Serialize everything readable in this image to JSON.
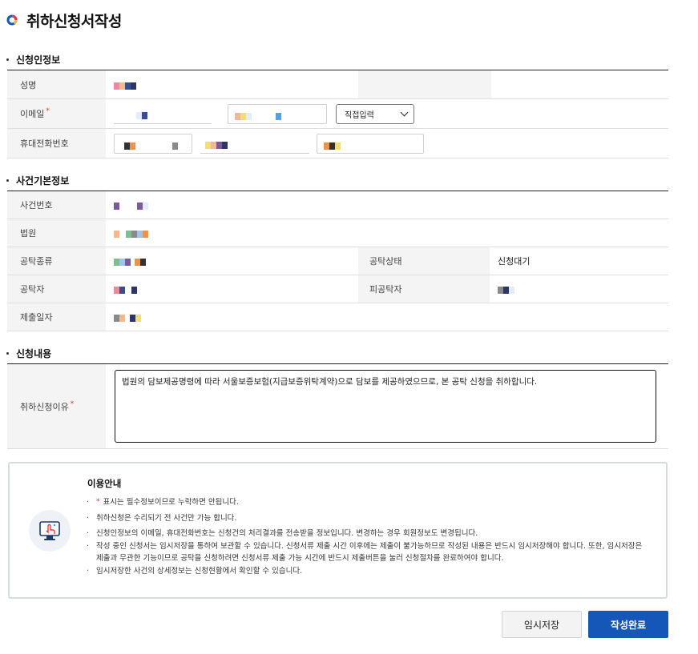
{
  "page": {
    "title": "취하신청서작성"
  },
  "applicant": {
    "section_title": "신청인정보",
    "name_label": "성명",
    "email_label": "이메일",
    "email_domain_select": "직접입력",
    "phone_label": "휴대전화번호"
  },
  "case_info": {
    "section_title": "사건기본정보",
    "case_number_label": "사건번호",
    "court_label": "법원",
    "deposit_type_label": "공탁종류",
    "deposit_status_label": "공탁상태",
    "deposit_status_value": "신청대기",
    "depositor_label": "공탁자",
    "depositee_label": "피공탁자",
    "submit_date_label": "제출일자"
  },
  "request": {
    "section_title": "신청내용",
    "reason_label": "취하신청이유",
    "reason_value": "법원의 담보제공명령에 따라 서울보증보험(지급보증위탁계약)으로 담보를 제공하였으므로, 본 공탁 신청을 취하합니다."
  },
  "guide": {
    "title": "이용안내",
    "items": [
      "표시는 필수정보이므로 누락하면 안됩니다.",
      "취하신청은 수리되기 전 사건만 가능 합니다.",
      "신청인정보의 이메일, 휴대전화번호는 신청건의 처리결과를 전송받을 정보입니다. 변경하는 경우 회원정보도 변경됩니다.",
      "작성 중인 신청서는 임시저장을 통하여 보관할 수 있습니다. 신청서류 제출 시간 이후에는 제출이 불가능하므로 작성된 내용은 반드시 임시저장해야 합니다. 또한, 임시저장은 제출과 무관한 기능이므로 공탁을 신청하려면 신청서류 제출 가능 시간에 반드시 제출버튼을 눌러 신청절차를 완료하여야 합니다.",
      "임시저장한 사건의 상세정보는 신청현황에서 확인할 수 있습니다."
    ]
  },
  "buttons": {
    "temp_save": "임시저장",
    "complete": "작성완료"
  },
  "colors": {
    "primary": "#1457b8",
    "required": "#dd3333"
  }
}
